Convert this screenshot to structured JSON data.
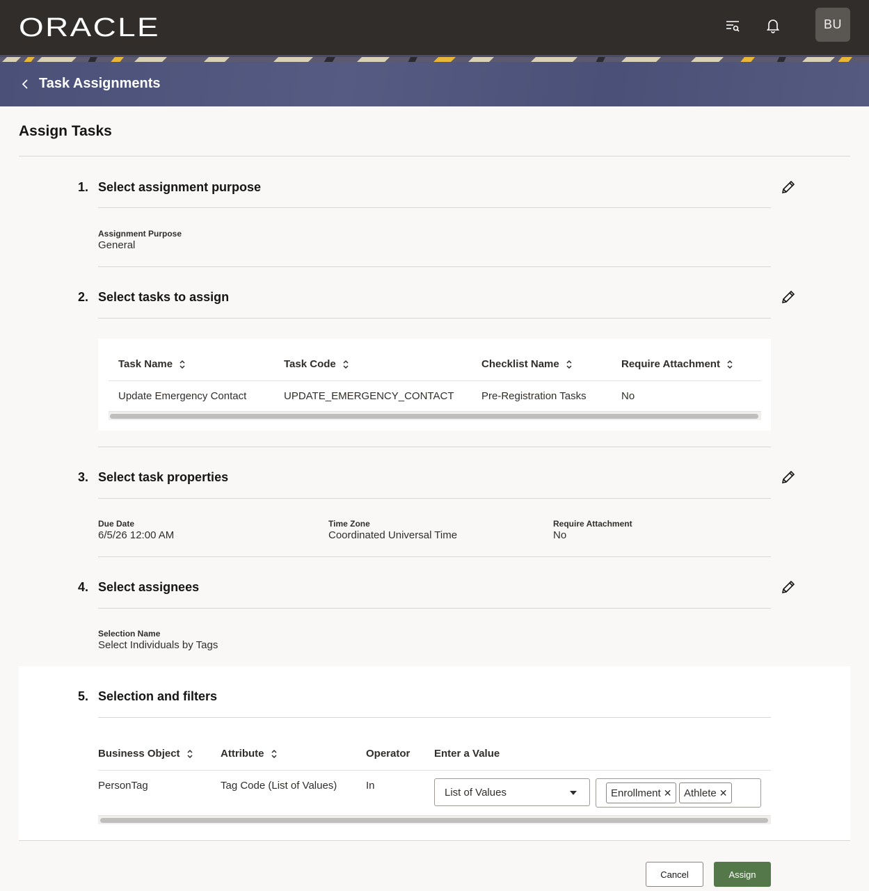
{
  "header": {
    "logo_text": "ORACLE",
    "avatar_initials": "BU"
  },
  "banner": {
    "title": "Task Assignments"
  },
  "page": {
    "title": "Assign Tasks"
  },
  "steps": [
    {
      "num": "1.",
      "title": "Select assignment purpose"
    },
    {
      "num": "2.",
      "title": "Select tasks to assign"
    },
    {
      "num": "3.",
      "title": "Select task properties"
    },
    {
      "num": "4.",
      "title": "Select assignees"
    },
    {
      "num": "5.",
      "title": "Selection and filters"
    }
  ],
  "purpose": {
    "label": "Assignment Purpose",
    "value": "General"
  },
  "tasks_table": {
    "columns": [
      "Task Name",
      "Task Code",
      "Checklist Name",
      "Require Attachment"
    ],
    "rows": [
      [
        "Update Emergency Contact",
        "UPDATE_EMERGENCY_CONTACT",
        "Pre-Registration Tasks",
        "No"
      ]
    ]
  },
  "properties": [
    {
      "label": "Due Date",
      "value": "6/5/26 12:00 AM"
    },
    {
      "label": "Time Zone",
      "value": "Coordinated Universal Time"
    },
    {
      "label": "Require Attachment",
      "value": "No"
    }
  ],
  "assignees": {
    "label": "Selection Name",
    "value": "Select Individuals by Tags"
  },
  "filters_table": {
    "columns": [
      "Business Object",
      "Attribute",
      "Operator",
      "Enter a Value"
    ],
    "row": {
      "business_object": "PersonTag",
      "attribute": "Tag Code (List of Values)",
      "operator": "In",
      "value_type": "List of Values",
      "chips": [
        "Enrollment",
        "Athlete"
      ]
    }
  },
  "actions": {
    "cancel": "Cancel",
    "assign": "Assign"
  },
  "colors": {
    "topbar": "#312d2a",
    "banner": "#4c5279",
    "assign_button": "#55784a",
    "page_bg": "#f9f8f6"
  }
}
